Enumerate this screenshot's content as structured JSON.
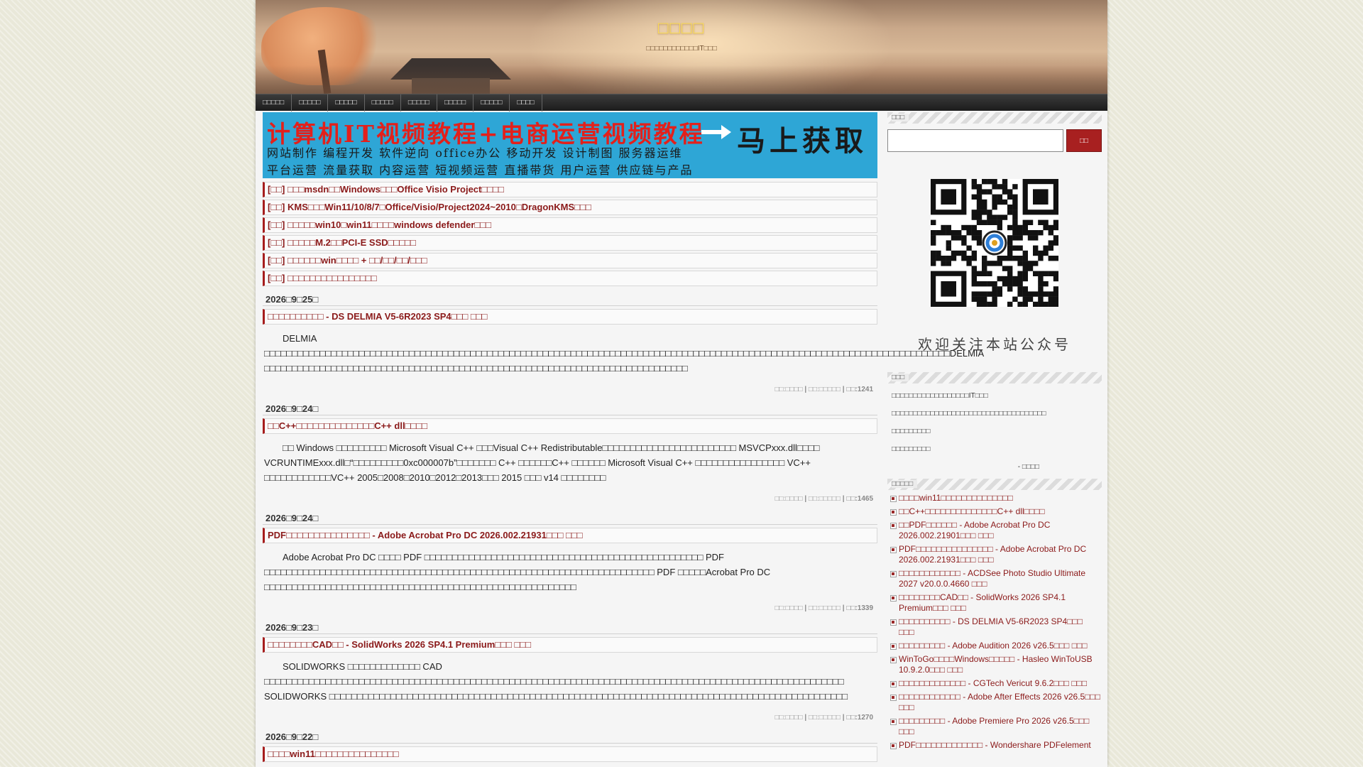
{
  "header": {
    "title": "□□□□",
    "subtitle": "□□□□□□□□□□□□IT□□□"
  },
  "nav": [
    "□□□□□",
    "□□□□□",
    "□□□□□",
    "□□□□□",
    "□□□□□",
    "□□□□□",
    "□□□□□",
    "□□□□"
  ],
  "banner": {
    "line1": "计算机IT视频教程+电商运营视频教程",
    "line2": "网站制作 编程开发 软件逆向 office办公  移动开发 设计制图 服务器运维",
    "line3": "平台运营 流量获取 内容运营 短视频运营 直播带货  用户运营 供应链与产品",
    "cta": "马上获取"
  },
  "pinned": [
    "[□□] □□□msdn□□Windows□□□Office Visio Project□□□□",
    "[□□] KMS□□□Win11/10/8/7□Office/Visio/Project2024~2010□DragonKMS□□□",
    "[□□] □□□□□win10□win11□□□□windows defender□□□",
    "[□□] □□□□□M.2□□PCI-E SSD□□□□□",
    "[□□] □□□□□□win□□□□ + □□/□□/□□/□□□",
    "[□□] □□□□□□□□□□□□□□□□"
  ],
  "posts": [
    {
      "date": "2026□9□25□",
      "title": "□□□□□□□□□□ - DS DELMIA V5-6R2023 SP4□□□ □□□",
      "body": "　　DELMIA □□□□□□□□□□□□□□□□□□□□□□□□□□□□□□□□□□□□□□□□□□□□□□□□□□□□□□□□□□□□□□□□□□□□□□□□□□□□□□□□□□□□□□□□□□□□□□□□□□□□□□□□□□□□□□□□□□□□□□□□□□□DELMIA □□□□□□□□□□□□□□□□□□□□□□□□□□□□□□□□□□□□□□□□□□□□□□□□□□□□□□□□□□□□□□□□□□□□□□□□□□□□",
      "meta": {
        "a": "□□:□□□□",
        "b": "□□:□□□□□",
        "c": "□□:1241"
      }
    },
    {
      "date": "2026□9□24□",
      "title": "□□C++□□□□□□□□□□□□□□C++ dll□□□□",
      "body": "　　□□ Windows □□□□□□□□□ Microsoft Visual C++ □□□Visual C++ Redistributable□□□□□□□□□□□□□□□□□□□□□□□□ MSVCPxxx.dll□□□□ VCRUNTIMExxx.dll□“□□□□□□□□□0xc000007b”□□□□□□□ C++ □□□□□□C++ □□□□□□ Microsoft Visual C++ □□□□□□□□□□□□□□□□ VC++ □□□□□□□□□□□□VC++ 2005□2008□2010□2012□2013□□□ 2015 □□□ v14 □□□□□□□□",
      "meta": {
        "a": "□□:□□□□",
        "b": "□□:□□□□□",
        "c": "□□:1465"
      }
    },
    {
      "date": "2026□9□24□",
      "title": "PDF□□□□□□□□□□□□□□□ - Adobe Acrobat Pro DC 2026.002.21931□□□ □□□",
      "body": "　　Adobe Acrobat Pro DC □□□□ PDF □□□□□□□□□□□□□□□□□□□□□□□□□□□□□□□□□□□□□□□□□□□□□□□□□□ PDF □□□□□□□□□□□□□□□□□□□□□□□□□□□□□□□□□□□□□□□□□□□□□□□□□□□□□□□□□□□□□□□□□□□□□□ PDF □□□□□Acrobat Pro DC □□□□□□□□□□□□□□□□□□□□□□□□□□□□□□□□□□□□□□□□□□□□□□□□□□□□□□□□",
      "meta": {
        "a": "□□:□□□□",
        "b": "□□:□□□□□",
        "c": "□□:1339"
      }
    },
    {
      "date": "2026□9□23□",
      "title": "□□□□□□□□CAD□□ - SolidWorks 2026 SP4.1 Premium□□□ □□□",
      "body": "　　SOLIDWORKS □□□□□□□□□□□□□ CAD □□□□□□□□□□□□□□□□□□□□□□□□□□□□□□□□□□□□□□□□□□□□□□□□□□□□□□□□□□□□□□□□□□□□□□□□□□□□□□□□□□□□□□□□□□□□□□□□□□□□□□□□ SOLIDWORKS □□□□□□□□□□□□□□□□□□□□□□□□□□□□□□□□□□□□□□□□□□□□□□□□□□□□□□□□□□□□□□□□□□□□□□□□□□□□□□□□□□□□□□□□□□□□□",
      "meta": {
        "a": "□□:□□□□",
        "b": "□□:□□□□□",
        "c": "□□:1270"
      }
    },
    {
      "date": "2026□9□22□",
      "title": "□□□□win11□□□□□□□□□□□□□□□",
      "body": "",
      "meta": {
        "a": "",
        "b": "",
        "c": ""
      }
    }
  ],
  "sidebar": {
    "search_heading": "□□□",
    "search_button": "□□",
    "qr_caption": "欢迎关注本站公众号",
    "notice_heading": "□□□",
    "notice": [
      "□□□□□□□□□□□□□□□□□□IT□□□",
      "□□□□□□□□□□□□□□□□□□□□□□□□□□□□□□□□□□□□",
      "□□□□□□□□□",
      "□□□□□□□□□"
    ],
    "notice_sig": "- □□□□",
    "recent_heading": "□□□□□",
    "recent": [
      "□□□□win11□□□□□□□□□□□□□□",
      "□□C++□□□□□□□□□□□□□□C++ dll□□□□",
      "□□PDF□□□□□□ - Adobe Acrobat Pro DC 2026.002.21901□□□ □□□",
      "PDF□□□□□□□□□□□□□□□ - Adobe Acrobat Pro DC 2026.002.21931□□□ □□□",
      "□□□□□□□□□□□□ - ACDSee Photo Studio Ultimate 2027 v20.0.0.4660 □□□",
      "□□□□□□□□CAD□□ - SolidWorks 2026 SP4.1 Premium□□□ □□□",
      "□□□□□□□□□□ - DS DELMIA V5-6R2023 SP4□□□ □□□",
      "□□□□□□□□□ - Adobe Audition 2026 v26.5□□□ □□□",
      "WinToGo□□□□Windows□□□□□ - Hasleo WinToUSB 10.9.2.0□□□ □□□",
      "□□□□□□□□□□□□□ - CGTech Vericut 9.6.2□□□ □□□",
      "□□□□□□□□□□□□ - Adobe After Effects 2026 v26.5□□□ □□□",
      "□□□□□□□□□ - Adobe Premiere Pro 2026 v26.5□□□ □□□",
      "PDF□□□□□□□□□□□□□ - Wondershare PDFelement"
    ]
  }
}
